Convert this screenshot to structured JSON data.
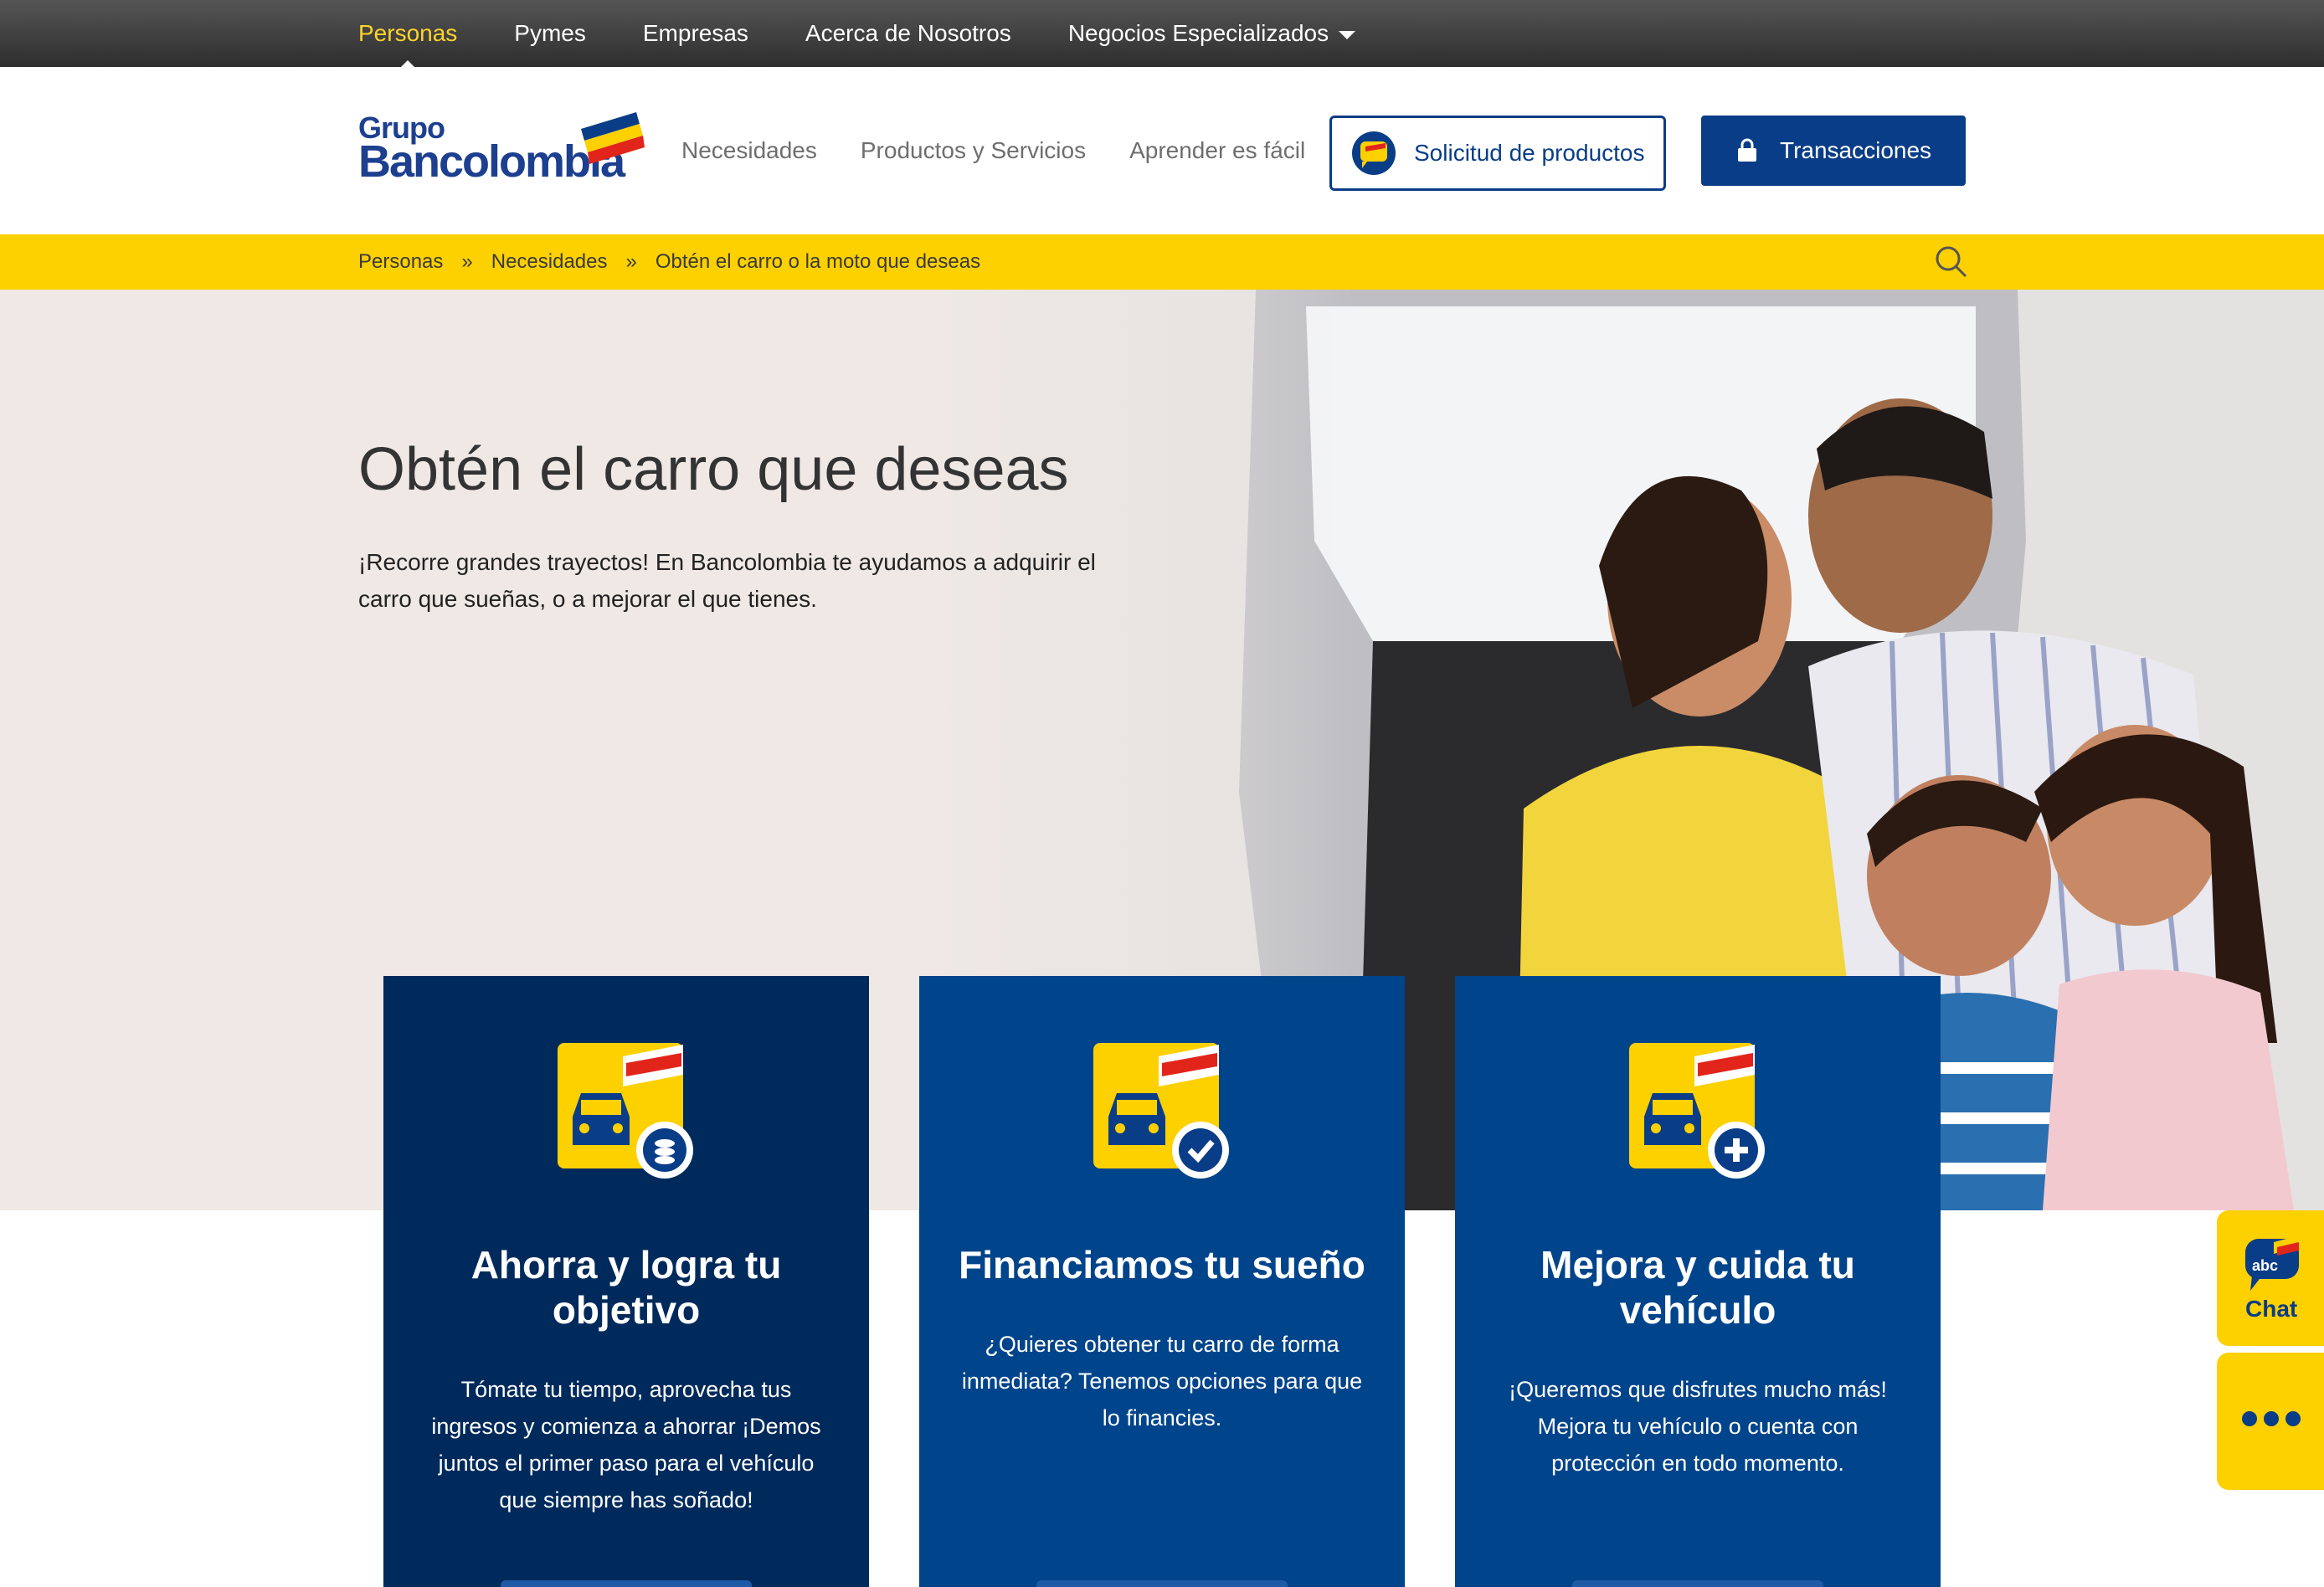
{
  "top_nav": {
    "items": [
      "Personas",
      "Pymes",
      "Empresas",
      "Acerca de Nosotros",
      "Negocios Especializados"
    ],
    "active": "Personas"
  },
  "logo": {
    "line1": "Grupo",
    "line2": "Bancolombia"
  },
  "main_nav": {
    "items": [
      "Necesidades",
      "Productos y Servicios",
      "Aprender es fácil"
    ]
  },
  "buttons": {
    "solicitud": "Solicitud de productos",
    "transacciones": "Transacciones"
  },
  "breadcrumb": {
    "items": [
      "Personas",
      "Necesidades",
      "Obtén el carro o la moto que deseas"
    ],
    "separator": "»"
  },
  "hero": {
    "title": "Obtén el carro que deseas",
    "text": "¡Recorre grandes trayectos! En Bancolombia te ayudamos a adquirir el carro que sueñas, o a mejorar el que tienes."
  },
  "cards": [
    {
      "title": "Ahorra y logra tu objetivo",
      "text": "Tómate tu tiempo, aprovecha tus ingresos y comienza a ahorrar ¡Demos juntos el primer paso para el vehículo que siempre has soñado!",
      "icon": "car-savings-icon"
    },
    {
      "title": "Financiamos tu sueño",
      "text": "¿Quieres obtener tu carro de forma inmediata? Tenemos opciones para que lo financies.",
      "icon": "car-check-icon"
    },
    {
      "title": "Mejora y cuida tu vehículo",
      "text": "¡Queremos que disfrutes mucho más! Mejora tu vehículo o cuenta con protección en todo momento.",
      "icon": "car-plus-icon"
    }
  ],
  "chat": {
    "badge": "abc",
    "label": "Chat"
  },
  "colors": {
    "brand_blue": "#0a3d87",
    "brand_yellow": "#fdd000",
    "card_dark": "#002a5c",
    "card_blue": "#00448b"
  }
}
